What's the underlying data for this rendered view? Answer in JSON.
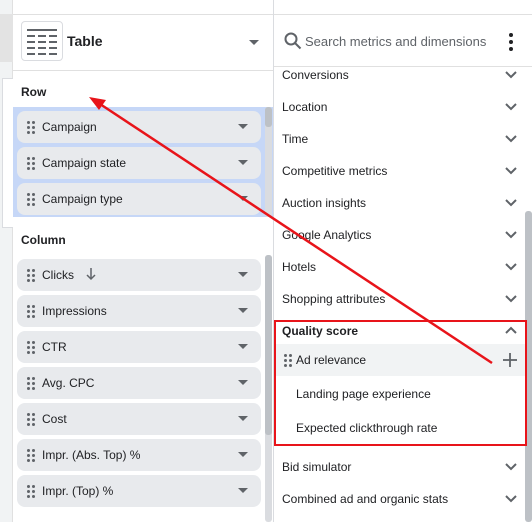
{
  "chart_type": {
    "label": "Table"
  },
  "row_section": {
    "title": "Row",
    "items": [
      {
        "label": "Campaign"
      },
      {
        "label": "Campaign state"
      },
      {
        "label": "Campaign type"
      }
    ]
  },
  "column_section": {
    "title": "Column",
    "items": [
      {
        "label": "Clicks",
        "sort": "descending"
      },
      {
        "label": "Impressions"
      },
      {
        "label": "CTR"
      },
      {
        "label": "Avg. CPC"
      },
      {
        "label": "Cost"
      },
      {
        "label": "Impr. (Abs. Top) %"
      },
      {
        "label": "Impr. (Top) %"
      }
    ]
  },
  "search": {
    "placeholder": "Search metrics and dimensions"
  },
  "categories": [
    {
      "label": "Conversions",
      "state": "collapsed"
    },
    {
      "label": "Location",
      "state": "collapsed"
    },
    {
      "label": "Time",
      "state": "collapsed"
    },
    {
      "label": "Competitive metrics",
      "state": "collapsed"
    },
    {
      "label": "Auction insights",
      "state": "collapsed"
    },
    {
      "label": "Google Analytics",
      "state": "collapsed"
    },
    {
      "label": "Hotels",
      "state": "collapsed"
    },
    {
      "label": "Shopping attributes",
      "state": "collapsed"
    },
    {
      "label": "Quality score",
      "state": "expanded"
    },
    {
      "label": "Bid simulator",
      "state": "collapsed"
    },
    {
      "label": "Combined ad and organic stats",
      "state": "collapsed"
    }
  ],
  "quality_score_items": [
    {
      "label": "Ad relevance",
      "hovered": true
    },
    {
      "label": "Landing page experience"
    },
    {
      "label": "Expected clickthrough rate"
    }
  ],
  "icons": {
    "chart_type": "table-chart-icon",
    "search": "search-icon",
    "more": "more-vert-icon",
    "drag": "drag-handle-icon",
    "add": "add-icon",
    "expand": "chevron-down-icon",
    "collapse": "chevron-up-icon",
    "sort": "arrow-down-icon"
  },
  "colors": {
    "drop_zone": "#c6d7f7",
    "chip": "#e8eaed",
    "annotation": "#e8141a"
  }
}
